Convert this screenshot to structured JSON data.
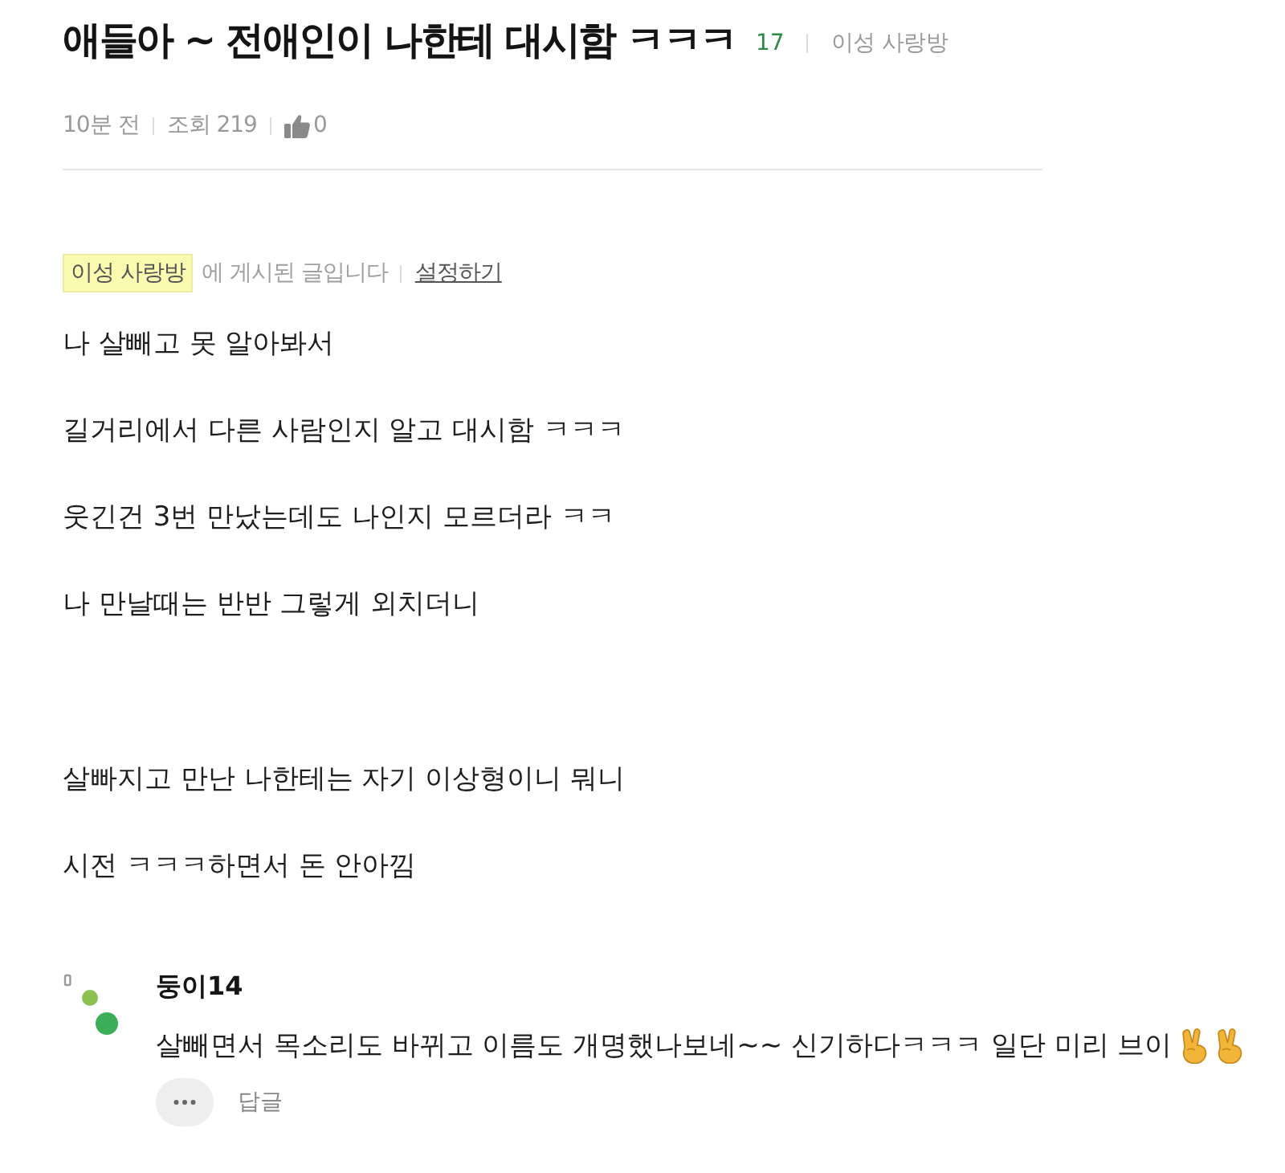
{
  "post": {
    "title": "애들아 ~ 전애인이 나한테 대시함 ㅋㅋㅋ",
    "comment_count": "17",
    "board": "이성 사랑방"
  },
  "meta": {
    "time": "10분 전",
    "views": "조회 219",
    "likes": "0"
  },
  "board_notice": {
    "board": "이성 사랑방",
    "text": "에 게시된 글입니다",
    "link": "설정하기"
  },
  "body_sections": [
    [
      "나 살빼고 못 알아봐서",
      "길거리에서 다른 사람인지 알고 대시함 ㅋㅋㅋ",
      "웃긴건 3번 만났는데도 나인지 모르더라 ㅋㅋ",
      "나 만날때는 반반 그렇게 외치더니"
    ],
    [
      "살빠지고 만난 나한테는 자기 이상형이니 뭐니",
      "시전 ㅋㅋㅋ하면서 돈 안아낌"
    ]
  ],
  "comments": [
    {
      "author": "둥이14",
      "text": "살빼면서 목소리도 바뀌고 이름도 개명했나보네~~ 신기하다ㅋㅋㅋ 일단 미리 브이",
      "reply": "답글"
    }
  ]
}
